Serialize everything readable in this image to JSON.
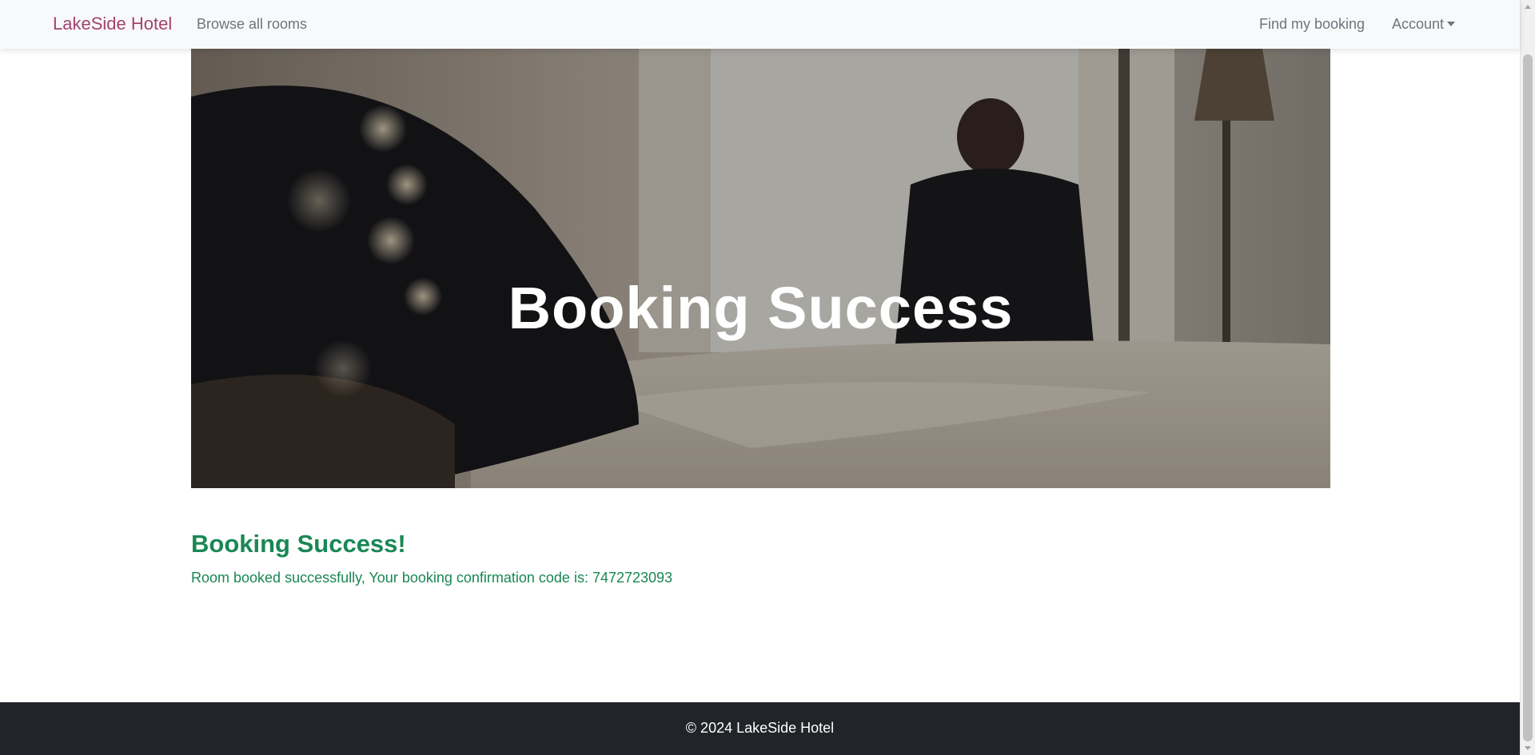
{
  "navbar": {
    "brand": "LakeSide Hotel",
    "browse_rooms": "Browse all rooms",
    "find_booking": "Find my booking",
    "account": "Account"
  },
  "hero": {
    "title": "Booking Success"
  },
  "main": {
    "heading": "Booking Success!",
    "message": "Room booked successfully, Your booking confirmation code is: 7472723093"
  },
  "footer": {
    "copyright": "© 2024 LakeSide Hotel"
  },
  "colors": {
    "brand": "#a3436f",
    "success": "#198754",
    "navbar_bg": "#f8f9fa",
    "footer_bg": "#212529"
  }
}
